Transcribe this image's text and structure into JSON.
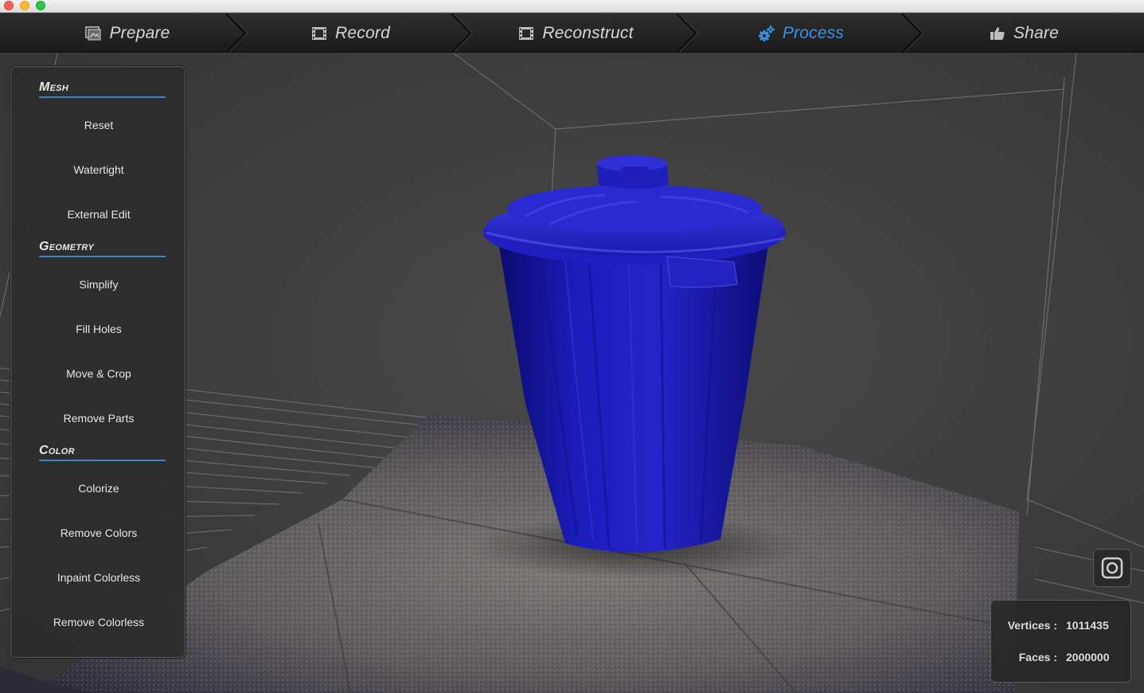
{
  "tabs": [
    {
      "label": "Prepare",
      "icon": "picture-icon",
      "active": false
    },
    {
      "label": "Record",
      "icon": "film-icon",
      "active": false
    },
    {
      "label": "Reconstruct",
      "icon": "film-icon",
      "active": false
    },
    {
      "label": "Process",
      "icon": "gears-icon",
      "active": true
    },
    {
      "label": "Share",
      "icon": "thumbs-up-icon",
      "active": false
    }
  ],
  "panel": {
    "mesh": {
      "title": "Mesh",
      "buttons": [
        "Reset",
        "Watertight",
        "External Edit"
      ]
    },
    "geometry": {
      "title": "Geometry",
      "buttons": [
        "Simplify",
        "Fill Holes",
        "Move & Crop",
        "Remove Parts"
      ]
    },
    "color": {
      "title": "Color",
      "buttons": [
        "Colorize",
        "Remove Colors",
        "Inpaint Colorless",
        "Remove Colorless"
      ]
    }
  },
  "stats": {
    "vertices_label": "Vertices :",
    "vertices_value": "1011435",
    "faces_label": "Faces :",
    "faces_value": "2000000"
  },
  "colors": {
    "accent": "#3d8fe8",
    "bin_blue": "#1f1fc4",
    "panel_bg": "#2c2c2c"
  }
}
